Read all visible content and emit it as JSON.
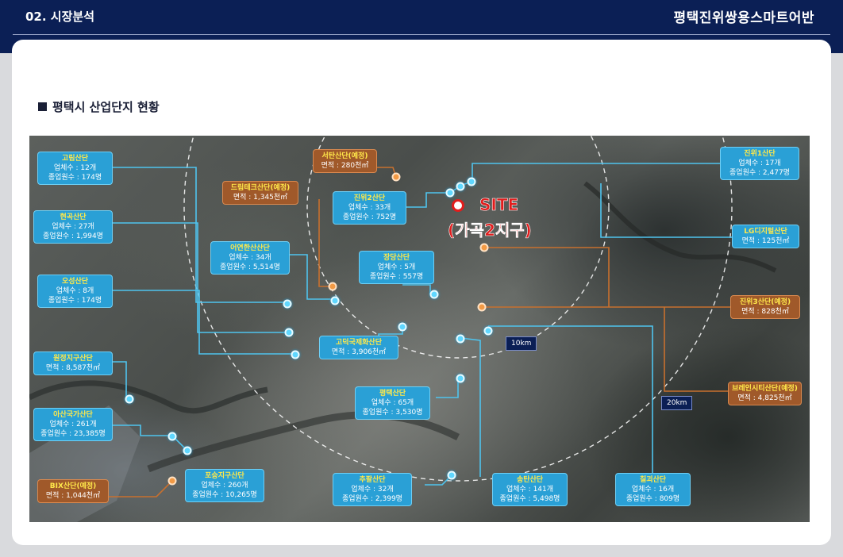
{
  "header": {
    "section": "02. 시장분석",
    "project": "평택진위쌍용스마트어반"
  },
  "section_title": "평택시 산업단지 현황",
  "map": {
    "site": {
      "label": "SITE",
      "sublabel": "(가곡2지구)"
    },
    "radius_tags": [
      "10km",
      "20km"
    ],
    "complexes": [
      {
        "id": "gorim",
        "name": "고림산단",
        "lines": [
          "업체수 : 12개",
          "종업원수 : 174명"
        ],
        "status": "existing"
      },
      {
        "id": "hyeongok",
        "name": "현곡산단",
        "lines": [
          "업체수 : 27개",
          "종업원수 : 1,994명"
        ],
        "status": "existing"
      },
      {
        "id": "oseong",
        "name": "오성산단",
        "lines": [
          "업체수 : 8개",
          "종업원수 : 174명"
        ],
        "status": "existing"
      },
      {
        "id": "wonjeong",
        "name": "원정지구산단",
        "lines": [
          "면적 : 8,587천㎡"
        ],
        "status": "existing"
      },
      {
        "id": "asanguk",
        "name": "아산국가산단",
        "lines": [
          "업체수 : 261개",
          "종업원수 : 23,385명"
        ],
        "status": "existing"
      },
      {
        "id": "bix",
        "name": "BIX산단(예정)",
        "lines": [
          "면적 : 1,044천㎡"
        ],
        "status": "planned"
      },
      {
        "id": "poseung",
        "name": "포승지구산단",
        "lines": [
          "업체수 : 260개",
          "종업원수 : 10,265명"
        ],
        "status": "existing"
      },
      {
        "id": "drumtech",
        "name": "드림테크산단(예정)",
        "lines": [
          "면적 : 1,345천㎡"
        ],
        "status": "planned"
      },
      {
        "id": "eoyeon",
        "name": "어연한산산단",
        "lines": [
          "업체수 : 34개",
          "종업원수 : 5,514명"
        ],
        "status": "existing"
      },
      {
        "id": "seotan",
        "name": "서탄산단(예정)",
        "lines": [
          "면적 : 280천㎡"
        ],
        "status": "planned"
      },
      {
        "id": "jinwi2",
        "name": "진위2산단",
        "lines": [
          "업체수 : 33개",
          "종업원수 : 752명"
        ],
        "status": "existing"
      },
      {
        "id": "jangdang",
        "name": "장당산단",
        "lines": [
          "업체수 : 5개",
          "종업원수 : 557명"
        ],
        "status": "existing"
      },
      {
        "id": "godeok",
        "name": "고덕국제화산단",
        "lines": [
          "면적 : 3,906천㎡"
        ],
        "status": "existing"
      },
      {
        "id": "pyeongtaek",
        "name": "평택산단",
        "lines": [
          "업체수 : 65개",
          "종업원수 : 3,530명"
        ],
        "status": "existing"
      },
      {
        "id": "chupal",
        "name": "추팔산단",
        "lines": [
          "업체수 : 32개",
          "종업원수 : 2,399명"
        ],
        "status": "existing"
      },
      {
        "id": "songtan",
        "name": "송탄산단",
        "lines": [
          "업체수 : 141개",
          "종업원수 : 5,498명"
        ],
        "status": "existing"
      },
      {
        "id": "chilgoe",
        "name": "칠괴산단",
        "lines": [
          "업체수 : 16개",
          "종업원수 : 809명"
        ],
        "status": "existing"
      },
      {
        "id": "jinwi1",
        "name": "진위1산단",
        "lines": [
          "업체수 : 17개",
          "종업원수 : 2,477명"
        ],
        "status": "existing"
      },
      {
        "id": "lgdigital",
        "name": "LG디지털산단",
        "lines": [
          "면적 : 125천㎡"
        ],
        "status": "existing"
      },
      {
        "id": "jinwi3",
        "name": "진위3산단(예정)",
        "lines": [
          "면적 : 828천㎡"
        ],
        "status": "planned"
      },
      {
        "id": "brain",
        "name": "브레인시티산단(예정)",
        "lines": [
          "면적 : 4,825천㎡"
        ],
        "status": "planned"
      }
    ]
  }
}
